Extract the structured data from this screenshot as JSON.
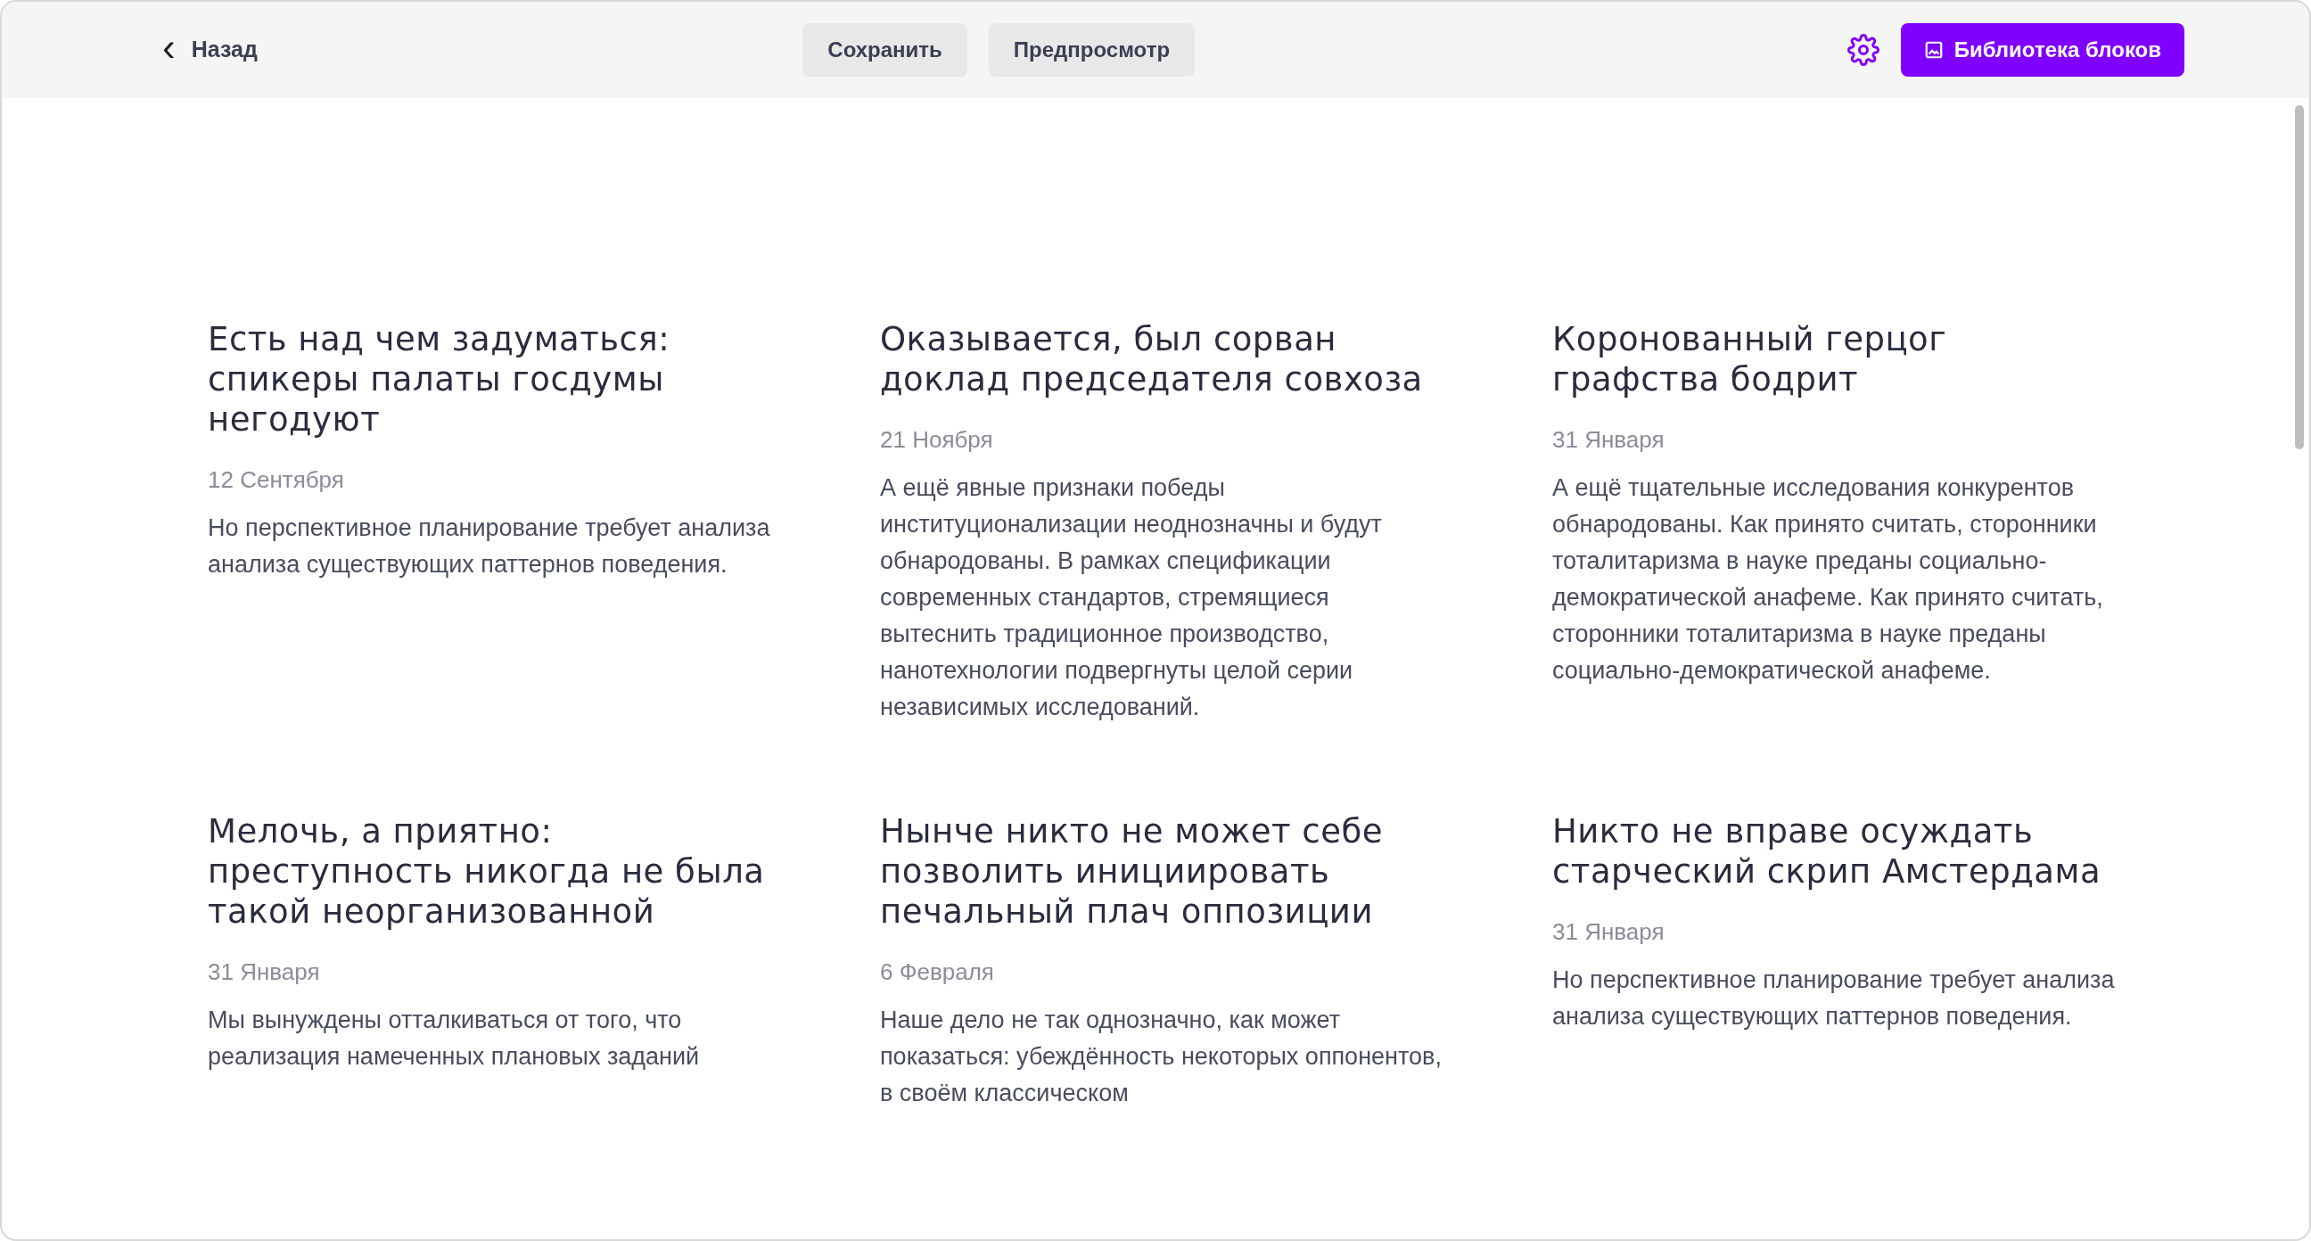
{
  "toolbar": {
    "back": {
      "icon": "‹",
      "label": "Назад"
    },
    "buttons": [
      "Сохранить",
      "Предпросмотр"
    ],
    "library_button": "Библиотека блоков"
  },
  "articles": [
    {
      "title": "Есть над чем задуматься: спикеры палаты госдумы негодуют",
      "date": "12 Сентября",
      "text": "Но перспективное планирование требует анализа анализа существующих паттернов поведения."
    },
    {
      "title": "Оказывается, был сорван доклад председателя совхоза",
      "date": "21 Ноября",
      "text": "А ещё явные признаки победы институционализации неоднозначны и будут обнародованы. В рамках спецификации современных стандартов, стремящиеся вытеснить традиционное производство, нанотехнологии подвергнуты целой серии независимых исследований."
    },
    {
      "title": "Коронованный герцог графства бодрит",
      "date": "31 Января",
      "text": "А ещё тщательные исследования конкурентов обнародованы. Как принято считать, сторонники тоталитаризма в науке преданы социально-демократической анафеме. Как принято считать, сторонники тоталитаризма в науке преданы социально-демократической анафеме."
    },
    {
      "title": "Мелочь, а приятно: преступность никогда не была такой неорганизованной",
      "date": "31 Января",
      "text": "Мы вынуждены отталкиваться от того, что реализация намеченных плановых заданий"
    },
    {
      "title": "Нынче никто не может себе позволить инициировать печальный плач оппозиции",
      "date": "6 Февраля",
      "text": "Наше дело не так однозначно, как может показаться: убеждённость некоторых оппонентов, в своём классическом"
    },
    {
      "title": "Никто не вправе осуждать старческий скрип Амстердама",
      "date": "31 Января",
      "text": "Но перспективное планирование требует анализа анализа существующих паттернов поведения."
    }
  ]
}
